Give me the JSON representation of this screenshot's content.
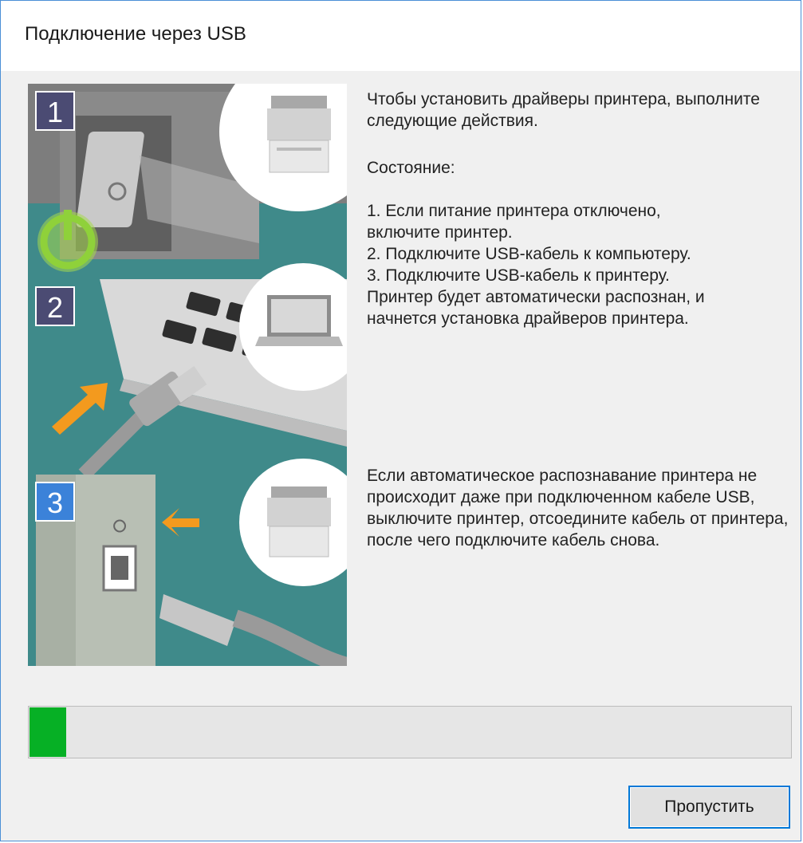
{
  "window": {
    "title": "Подключение через USB"
  },
  "illustration": {
    "step_badges": [
      "1",
      "2",
      "3"
    ],
    "icons": [
      "power-switch-icon",
      "printer-icon",
      "laptop-icon",
      "usb-cable-icon",
      "usb-port-icon",
      "orange-arrow-icon",
      "power-button-icon"
    ],
    "colors": {
      "badge_dark": "#4b4b73",
      "badge_blue": "#3b82d9",
      "power_green": "#8fd13a",
      "arrow_orange": "#f39a1e",
      "teal": "#3f8a8a"
    }
  },
  "instructions": {
    "intro": "Чтобы установить драйверы принтера, выполните следующие действия.",
    "status_label": "Состояние:",
    "steps": [
      "1. Если питание принтера отключено,",
      "включите принтер.",
      "2. Подключите USB-кабель к компьютеру.",
      "3. Подключите USB-кабель к принтеру.",
      "Принтер будет автоматически распознан, и",
      "начнется установка драйверов принтера."
    ],
    "note": "Если автоматическое распознавание принтера не происходит даже при подключенном кабеле USB, выключите принтер, отсоедините кабель от принтера, после чего подключите кабель снова."
  },
  "progress": {
    "value_percent": 5,
    "color": "#06b025"
  },
  "buttons": {
    "skip": "Пропустить"
  }
}
